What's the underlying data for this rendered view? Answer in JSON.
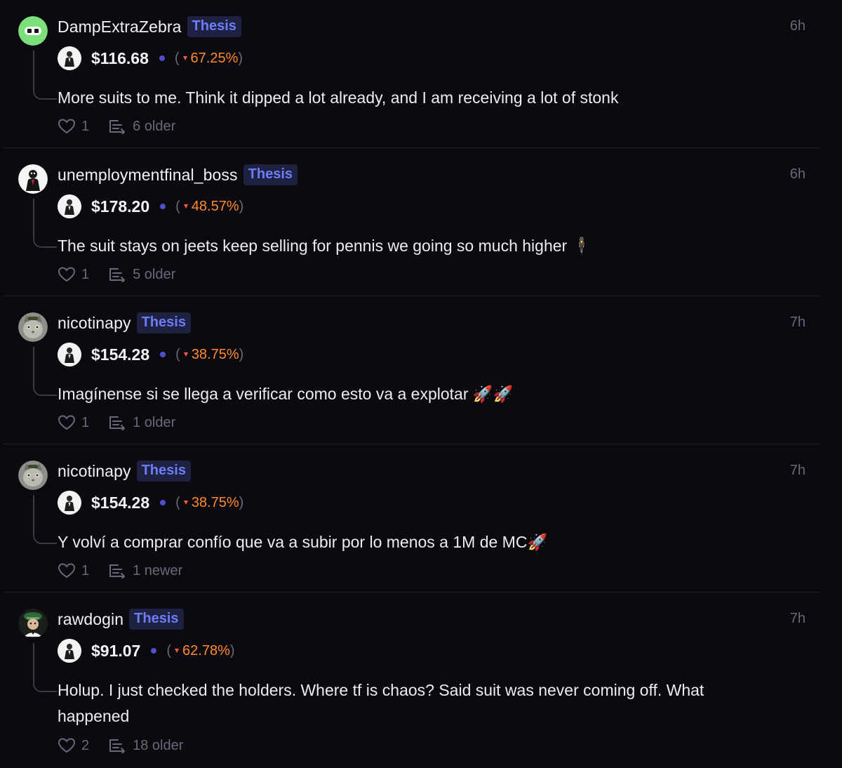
{
  "posts": [
    {
      "username": "DampExtraZebra",
      "badge": "Thesis",
      "time": "6h",
      "price": "$116.68",
      "change_paren_open": "(",
      "change": "67.25%",
      "change_paren_close": ")",
      "text": "More suits to me. Think it dipped a lot already, and I am receiving a lot of stonk",
      "likes": "1",
      "thread": "6 older",
      "avatar_icon": "green-mask-avatar"
    },
    {
      "username": "unemploymentfinal_boss",
      "badge": "Thesis",
      "time": "6h",
      "price": "$178.20",
      "change_paren_open": "(",
      "change": "48.57%",
      "change_paren_close": ")",
      "text": "The suit stays on jeets keep selling for pennis we going so much higher 🕴",
      "likes": "1",
      "thread": "5 older",
      "avatar_icon": "penguin-suit-avatar"
    },
    {
      "username": "nicotinapy",
      "badge": "Thesis",
      "time": "7h",
      "price": "$154.28",
      "change_paren_open": "(",
      "change": "38.75%",
      "change_paren_close": ")",
      "text": "Imagínense si se llega a verificar como esto va a explotar 🚀🚀",
      "likes": "1",
      "thread": "1 older",
      "avatar_icon": "cat-avatar"
    },
    {
      "username": "nicotinapy",
      "badge": "Thesis",
      "time": "7h",
      "price": "$154.28",
      "change_paren_open": "(",
      "change": "38.75%",
      "change_paren_close": ")",
      "text": "Y volví a comprar confío que va a subir por lo menos a 1M de MC🚀",
      "likes": "1",
      "thread": "1 newer",
      "avatar_icon": "cat-avatar"
    },
    {
      "username": "rawdogin",
      "badge": "Thesis",
      "time": "7h",
      "price": "$91.07",
      "change_paren_open": "(",
      "change": "62.78%",
      "change_paren_close": ")",
      "text": "Holup. I just checked the holders. Where tf is chaos? Said suit was never coming off. What happened",
      "likes": "2",
      "thread": "18 older",
      "avatar_icon": "soldier-avatar"
    }
  ],
  "colors": {
    "background": "#0b0a10",
    "badge_bg": "#1e2240",
    "badge_text": "#6d7dfb",
    "change_text": "#ff8a2b",
    "muted": "#6a6975",
    "dot": "#4f4fd0"
  }
}
